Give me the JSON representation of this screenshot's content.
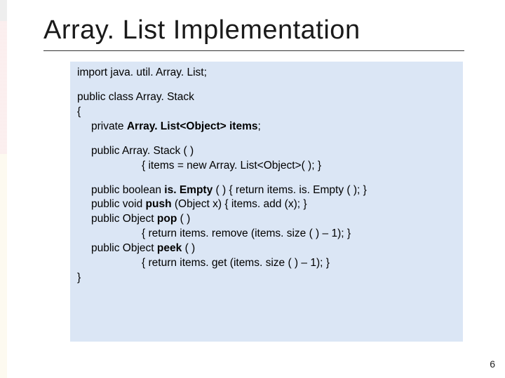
{
  "title": "Array. List Implementation",
  "page_number": "6",
  "code": {
    "l1": "import java. util. Array. List;",
    "l2a": "public class Array. Stack",
    "l2b": "{",
    "l3a": "private ",
    "l3b": "Array. List<Object> items",
    "l3c": ";",
    "l4": "public Array. Stack ( )",
    "l5": "{  items = new Array. List<Object>( );  }",
    "l6a": "public boolean ",
    "l6b": "is. Empty",
    "l6c": " ( )   {  return items. is. Empty ( );  }",
    "l7a": "public void ",
    "l7b": "push",
    "l7c": " (Object x)   {  items. add (x);  }",
    "l8a": "public Object ",
    "l8b": "pop",
    "l8c": " ( )",
    "l9": "{  return items. remove (items. size ( ) – 1);  }",
    "l10a": "public Object ",
    "l10b": "peek",
    "l10c": " ( )",
    "l11": "{  return items. get (items. size ( ) – 1);  }",
    "l12": "}"
  }
}
